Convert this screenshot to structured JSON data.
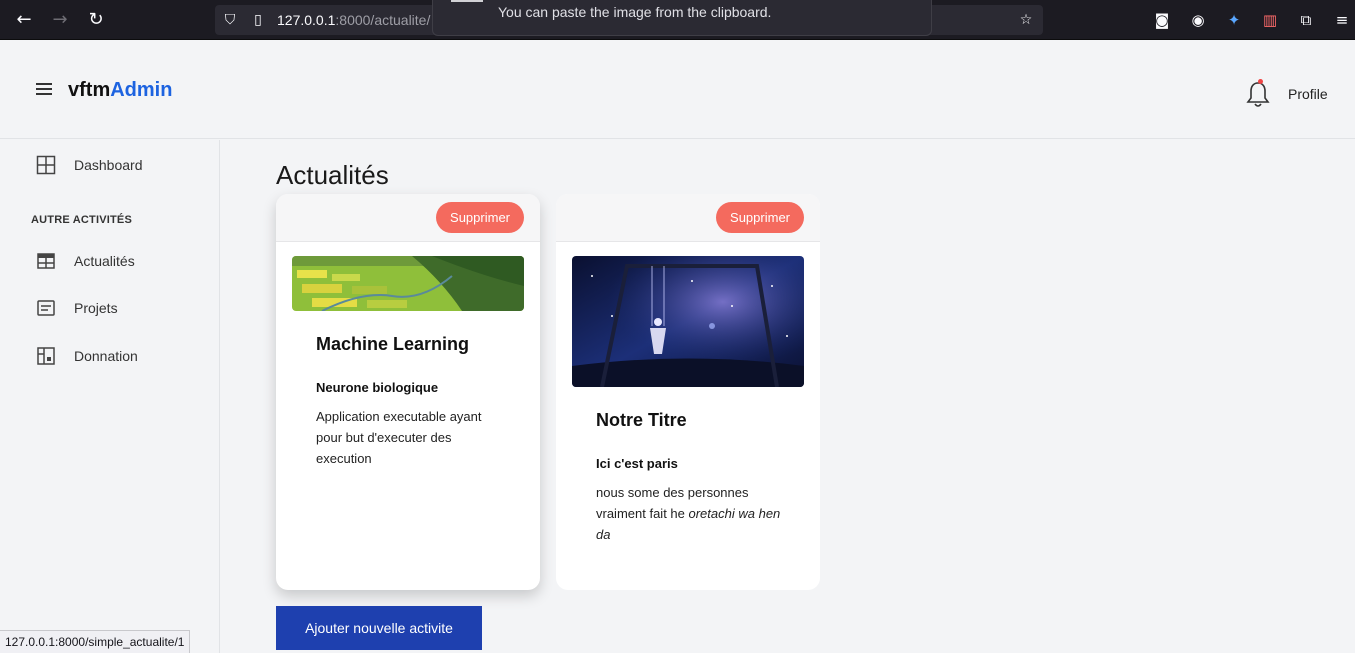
{
  "browser": {
    "url_host": "127.0.0.1",
    "url_path": ":8000/actualite/",
    "notification": "You can paste the image from the clipboard.",
    "status_url": "127.0.0.1:8000/simple_actualite/1"
  },
  "header": {
    "brand_main": "vftm",
    "brand_accent": "Admin",
    "profile_label": "Profile"
  },
  "sidebar": {
    "dashboard": "Dashboard",
    "section_heading": "AUTRE ACTIVITÉS",
    "items": [
      "Actualités",
      "Projets",
      "Donnation"
    ]
  },
  "main": {
    "title": "Actualités",
    "add_button": "Ajouter nouvelle activite",
    "cards": [
      {
        "delete_label": "Supprimer",
        "title": "Machine Learning",
        "subtitle": "Neurone biologique",
        "description": "Application executable ayant pour but d'executer des execution"
      },
      {
        "delete_label": "Supprimer",
        "title": "Notre Titre",
        "subtitle": "Ici c'est paris",
        "description_plain": "nous some des personnes vraiment fait he ",
        "description_italic": "oretachi wa hen da"
      }
    ]
  },
  "colors": {
    "accent": "#1d63e0",
    "delete": "#f46a5e",
    "primary_button": "#1e40af"
  }
}
